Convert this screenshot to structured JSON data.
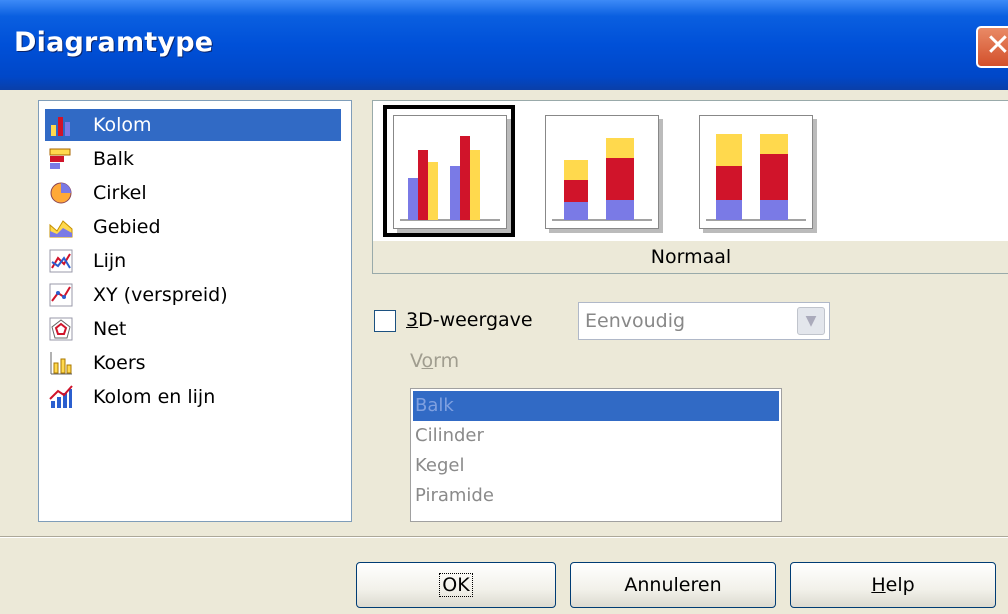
{
  "window": {
    "title": "Diagramtype"
  },
  "chart_types": [
    {
      "label": "Kolom",
      "icon": "column-chart-icon",
      "selected": true
    },
    {
      "label": "Balk",
      "icon": "bar-chart-icon"
    },
    {
      "label": "Cirkel",
      "icon": "pie-chart-icon"
    },
    {
      "label": "Gebied",
      "icon": "area-chart-icon"
    },
    {
      "label": "Lijn",
      "icon": "line-chart-icon"
    },
    {
      "label": "XY (verspreid)",
      "icon": "xy-scatter-chart-icon"
    },
    {
      "label": "Net",
      "icon": "net-chart-icon"
    },
    {
      "label": "Koers",
      "icon": "stock-chart-icon"
    },
    {
      "label": "Kolom en lijn",
      "icon": "column-line-chart-icon"
    }
  ],
  "variants": {
    "caption": "Normaal",
    "items": [
      "normal",
      "stacked",
      "percent-stacked"
    ],
    "selected_index": 0
  },
  "options": {
    "three_d_prefix": "3",
    "three_d_rest": "D-weergave",
    "three_d_checked": false,
    "style_value": "Eenvoudig",
    "shape_label_prefix": "V",
    "shape_label_accel": "o",
    "shape_label_rest": "rm",
    "shapes": [
      "Balk",
      "Cilinder",
      "Kegel",
      "Piramide"
    ],
    "selected_shape": "Balk"
  },
  "buttons": {
    "ok": "OK",
    "cancel": "Annuleren",
    "help_accel": "H",
    "help_rest": "elp"
  },
  "colors": {
    "selection": "#316ac5",
    "titlebar": "#0050d8",
    "bar_blue": "#7a7ae6",
    "bar_red": "#d0142a",
    "bar_yellow": "#ffd94d"
  }
}
